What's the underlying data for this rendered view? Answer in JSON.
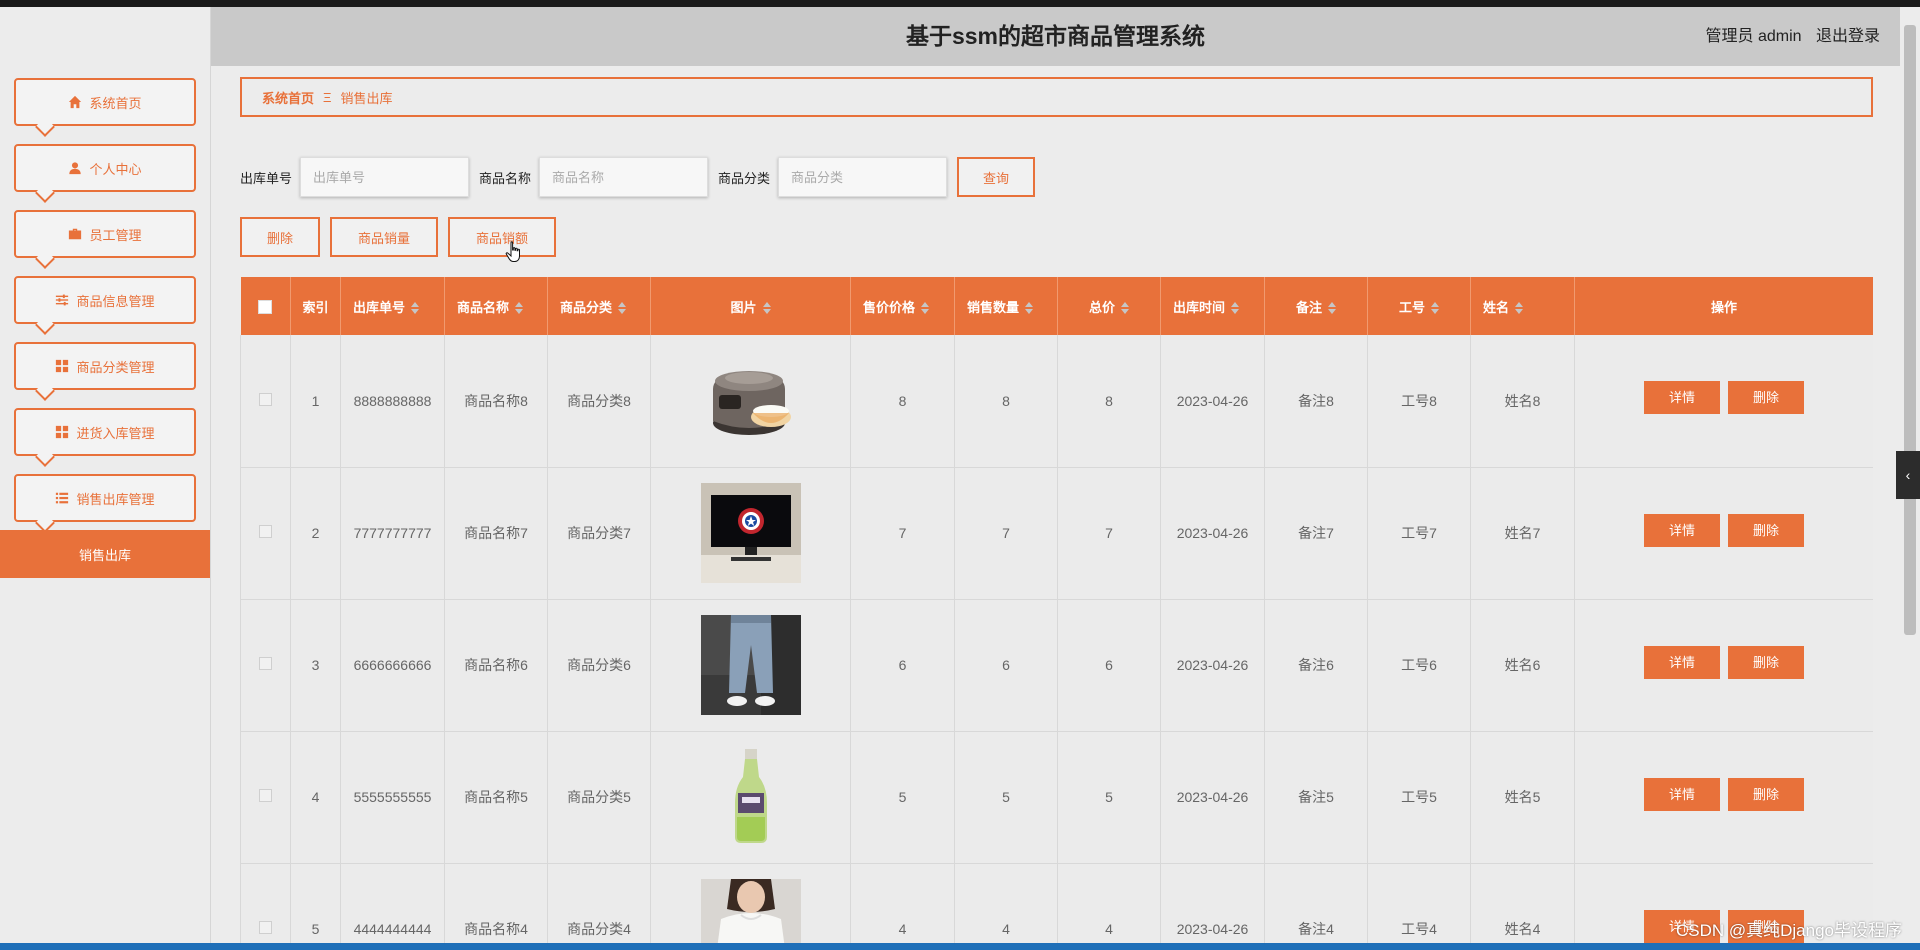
{
  "header": {
    "title": "基于ssm的超市商品管理系统",
    "user_label": "管理员 admin",
    "logout_label": "退出登录"
  },
  "sidebar": {
    "items": [
      {
        "label": "系统首页",
        "icon": "home-icon"
      },
      {
        "label": "个人中心",
        "icon": "user-icon"
      },
      {
        "label": "员工管理",
        "icon": "briefcase-icon"
      },
      {
        "label": "商品信息管理",
        "icon": "sliders-icon"
      },
      {
        "label": "商品分类管理",
        "icon": "grid-icon"
      },
      {
        "label": "进货入库管理",
        "icon": "grid-icon"
      },
      {
        "label": "销售出库管理",
        "icon": "list-icon"
      }
    ],
    "active_sub": "销售出库"
  },
  "breadcrumb": {
    "home": "系统首页",
    "separator": "Ξ",
    "current": "销售出库"
  },
  "search": {
    "order_label": "出库单号",
    "order_placeholder": "出库单号",
    "name_label": "商品名称",
    "name_placeholder": "商品名称",
    "category_label": "商品分类",
    "category_placeholder": "商品分类",
    "query_label": "查询"
  },
  "actions": {
    "delete_label": "删除",
    "sales_qty_label": "商品销量",
    "sales_amount_label": "商品销额"
  },
  "table": {
    "columns": [
      "索引",
      "出库单号",
      "商品名称",
      "商品分类",
      "图片",
      "售价价格",
      "销售数量",
      "总价",
      "出库时间",
      "备注",
      "工号",
      "姓名",
      "操作"
    ],
    "detail_label": "详情",
    "delete_label": "删除",
    "rows": [
      {
        "index": "1",
        "order": "8888888888",
        "name": "商品名称8",
        "category": "商品分类8",
        "image": "rice-cooker",
        "price": "8",
        "qty": "8",
        "total": "8",
        "time": "2023-04-26",
        "note": "备注8",
        "emp_no": "工号8",
        "emp_name": "姓名8"
      },
      {
        "index": "2",
        "order": "7777777777",
        "name": "商品名称7",
        "category": "商品分类7",
        "image": "monitor",
        "price": "7",
        "qty": "7",
        "total": "7",
        "time": "2023-04-26",
        "note": "备注7",
        "emp_no": "工号7",
        "emp_name": "姓名7"
      },
      {
        "index": "3",
        "order": "6666666666",
        "name": "商品名称6",
        "category": "商品分类6",
        "image": "jeans",
        "price": "6",
        "qty": "6",
        "total": "6",
        "time": "2023-04-26",
        "note": "备注6",
        "emp_no": "工号6",
        "emp_name": "姓名6"
      },
      {
        "index": "4",
        "order": "5555555555",
        "name": "商品名称5",
        "category": "商品分类5",
        "image": "drink-bottle",
        "price": "5",
        "qty": "5",
        "total": "5",
        "time": "2023-04-26",
        "note": "备注5",
        "emp_no": "工号5",
        "emp_name": "姓名5"
      },
      {
        "index": "5",
        "order": "4444444444",
        "name": "商品名称4",
        "category": "商品分类4",
        "image": "t-shirt",
        "price": "4",
        "qty": "4",
        "total": "4",
        "time": "2023-04-26",
        "note": "备注4",
        "emp_no": "工号4",
        "emp_name": "姓名4"
      }
    ]
  },
  "watermark": "CSDN @真纯Django毕设程序",
  "colors": {
    "accent": "#e8713a",
    "header_bg": "#c9c9c9",
    "page_bg": "#ececec"
  }
}
